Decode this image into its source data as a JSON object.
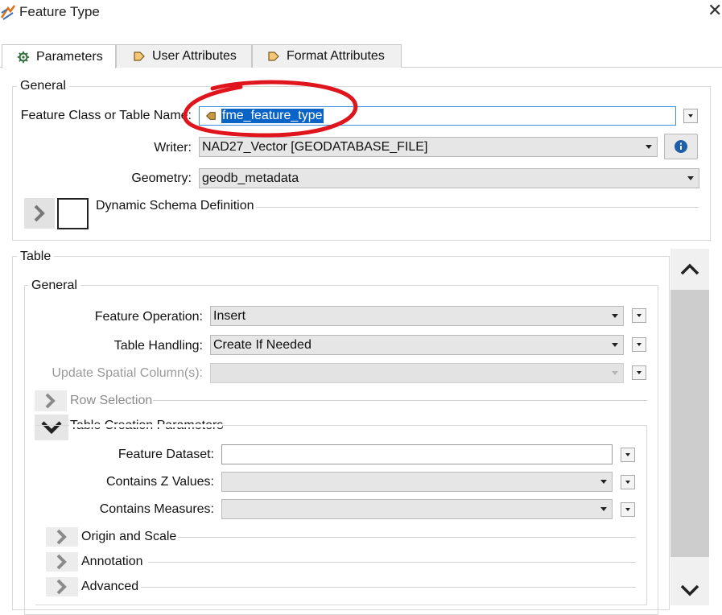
{
  "window": {
    "title": "Feature Type"
  },
  "tabs": [
    {
      "label": "Parameters",
      "icon": "gear-icon"
    },
    {
      "label": "User Attributes",
      "icon": "tag-icon"
    },
    {
      "label": "Format Attributes",
      "icon": "tag-icon"
    }
  ],
  "general": {
    "title": "General",
    "feature_class_label": "Feature Class or Table Name:",
    "feature_class_value": "fme_feature_type",
    "writer_label": "Writer:",
    "writer_value": "NAD27_Vector [GEODATABASE_FILE]",
    "geometry_label": "Geometry:",
    "geometry_value": "geodb_metadata",
    "dynamic_schema_label": "Dynamic Schema Definition"
  },
  "table": {
    "title": "Table",
    "general_title": "General",
    "feature_operation_label": "Feature Operation:",
    "feature_operation_value": "Insert",
    "table_handling_label": "Table Handling:",
    "table_handling_value": "Create If Needed",
    "update_spatial_label": "Update Spatial Column(s):",
    "update_spatial_value": "",
    "row_selection_label": "Row Selection",
    "table_creation_label": "Table Creation Parameters",
    "feature_dataset_label": "Feature Dataset:",
    "feature_dataset_value": "",
    "contains_z_label": "Contains Z Values:",
    "contains_z_value": "",
    "contains_measures_label": "Contains Measures:",
    "contains_measures_value": "",
    "origin_scale_label": "Origin and Scale",
    "annotation_label": "Annotation",
    "advanced_label": "Advanced"
  },
  "colors": {
    "selection": "#0a64c8",
    "annotation_circle": "#e0141c",
    "focus_border": "#3a8ee6"
  }
}
